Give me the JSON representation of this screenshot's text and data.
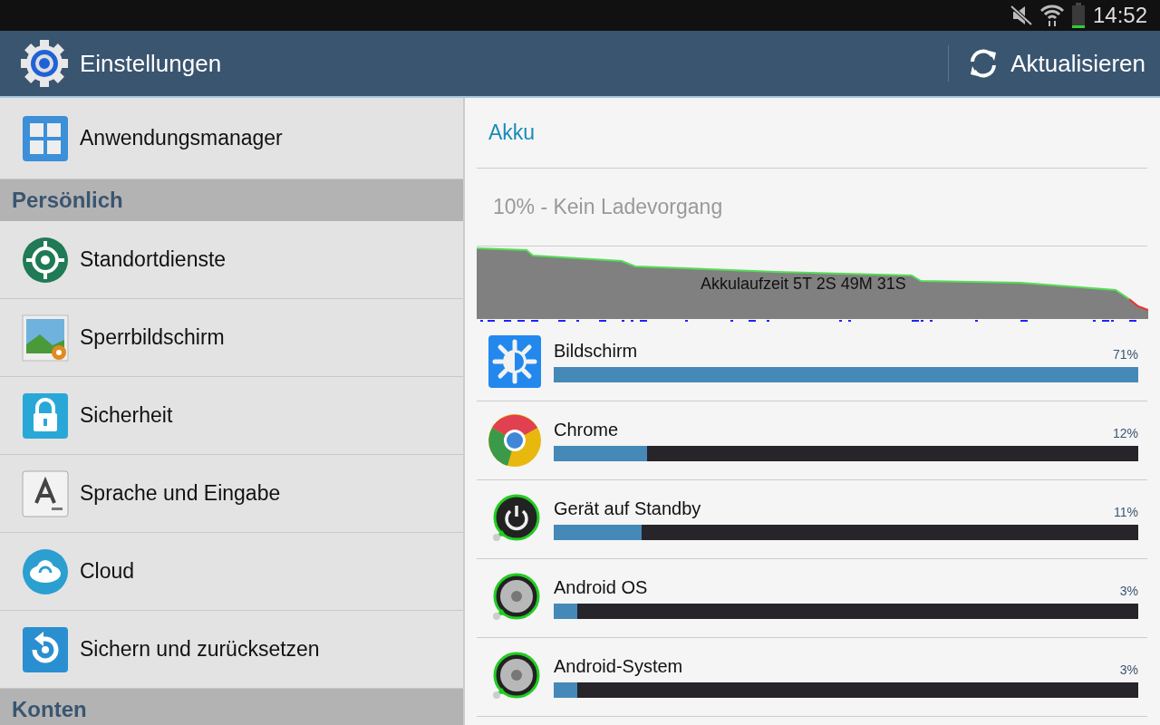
{
  "status_bar": {
    "time": "14:52"
  },
  "action_bar": {
    "title": "Einstellungen",
    "refresh_label": "Aktualisieren"
  },
  "sidebar": {
    "items": [
      {
        "kind": "item",
        "label": "Anwendungsmanager"
      },
      {
        "kind": "header",
        "label": "Persönlich"
      },
      {
        "kind": "item",
        "label": "Standortdienste"
      },
      {
        "kind": "item",
        "label": "Sperrbildschirm"
      },
      {
        "kind": "item",
        "label": "Sicherheit"
      },
      {
        "kind": "item",
        "label": "Sprache und Eingabe"
      },
      {
        "kind": "item",
        "label": "Cloud"
      },
      {
        "kind": "item",
        "label": "Sichern und zurücksetzen"
      },
      {
        "kind": "header",
        "label": "Konten"
      }
    ]
  },
  "battery": {
    "title": "Akku",
    "status": "10% - Kein Ladevorgang",
    "graph_label": "Akkulaufzeit 5T 2S 49M 31S",
    "usage": [
      {
        "name": "Bildschirm",
        "percent": "71%",
        "level": 1.0
      },
      {
        "name": "Chrome",
        "percent": "12%",
        "level": 0.16
      },
      {
        "name": "Gerät auf Standby",
        "percent": "11%",
        "level": 0.15
      },
      {
        "name": "Android OS",
        "percent": "3%",
        "level": 0.04
      },
      {
        "name": "Android-System",
        "percent": "3%",
        "level": 0.04
      }
    ]
  }
}
